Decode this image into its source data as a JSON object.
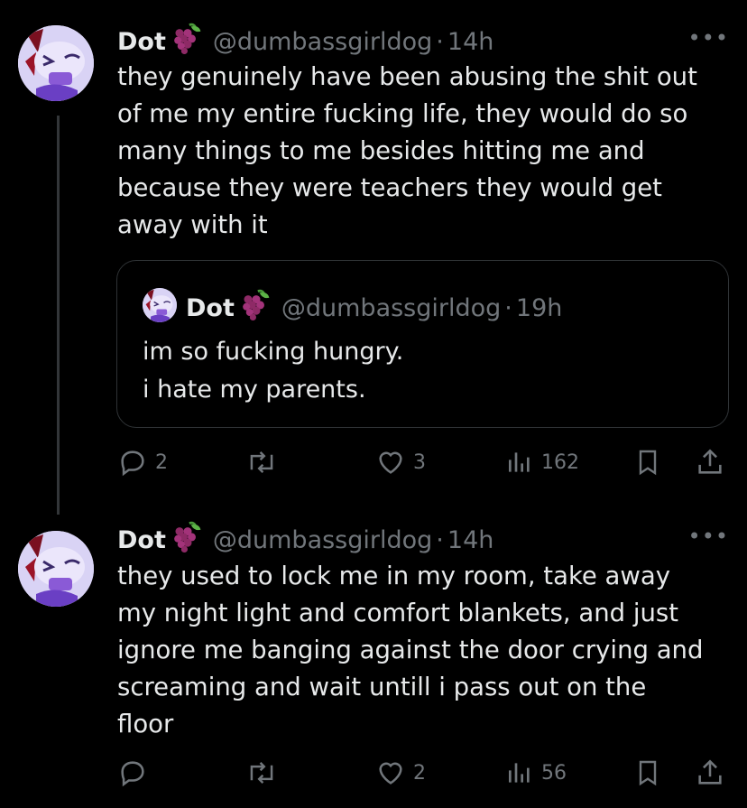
{
  "tweets": [
    {
      "name": "Dot",
      "emoji": "grapes-emoji",
      "handle": "@dumbassgirldog",
      "sep": "·",
      "time": "14h",
      "more_label": "•••",
      "text": "they genuinely have been abusing the shit out\nof me my entire fucking life, they would do so\nmany things to me besides hitting me and\nbecause they were teachers they would get\naway with it",
      "quote": {
        "name": "Dot",
        "emoji": "grapes-emoji",
        "handle": "@dumbassgirldog",
        "sep": "·",
        "time": "19h",
        "text": "im so fucking hungry.\ni hate my parents."
      },
      "actions": {
        "replies": "2",
        "retweets": "",
        "likes": "3",
        "views": "162"
      }
    },
    {
      "name": "Dot",
      "emoji": "grapes-emoji",
      "handle": "@dumbassgirldog",
      "sep": "·",
      "time": "14h",
      "more_label": "•••",
      "text": "they used to lock me in my room, take away\nmy night light and comfort blankets, and just\nignore me banging against the door crying and\nscreaming and wait untill i pass out on the\nfloor",
      "actions": {
        "replies": "",
        "retweets": "",
        "likes": "2",
        "views": "56"
      }
    }
  ],
  "colors": {
    "background": "#000000",
    "text": "#e7e9ea",
    "secondary": "#71767b",
    "border": "#2f3336",
    "avatar": "#d9d3f5"
  }
}
